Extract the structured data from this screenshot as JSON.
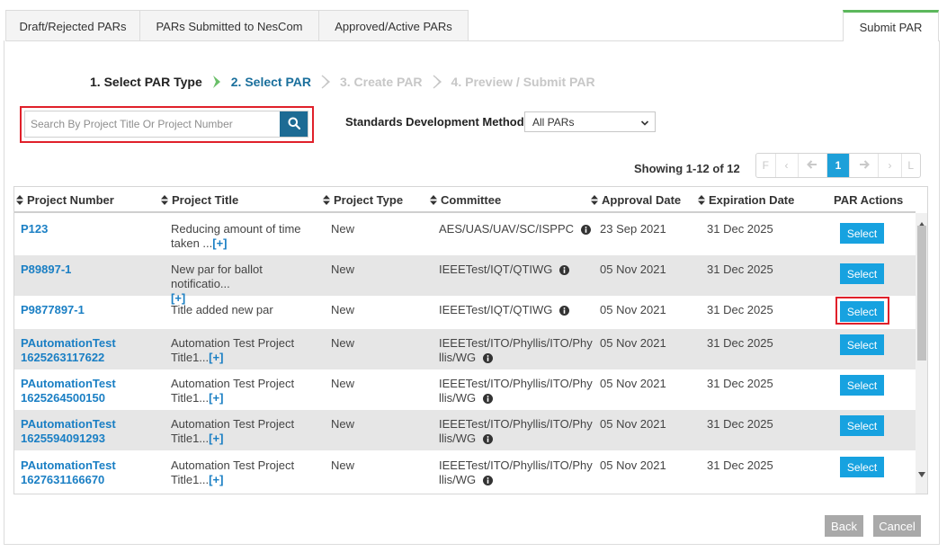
{
  "tabs": [
    {
      "label": "Draft/Rejected PARs"
    },
    {
      "label": "PARs Submitted to NesCom"
    },
    {
      "label": "Approved/Active PARs"
    },
    {
      "label": "Submit PAR"
    }
  ],
  "wizard": {
    "steps": [
      {
        "label": "1. Select PAR Type",
        "state": "done"
      },
      {
        "label": "2. Select PAR",
        "state": "current"
      },
      {
        "label": "3. Create PAR",
        "state": "future"
      },
      {
        "label": "4. Preview / Submit PAR",
        "state": "future"
      }
    ]
  },
  "search": {
    "placeholder": "Search By Project Title Or Project Number",
    "value": ""
  },
  "filter": {
    "label": "Standards Development Method:",
    "selected": "All PARs"
  },
  "pagination": {
    "showing": "Showing 1-12 of 12",
    "first": "F",
    "prev_small": "‹",
    "prev": "←",
    "current_page": "1",
    "next": "→",
    "next_small": "›",
    "last": "L"
  },
  "table": {
    "columns": [
      "Project Number",
      "Project Title",
      "Project Type",
      "Committee",
      "Approval Date",
      "Expiration Date",
      "PAR Actions"
    ],
    "rows": [
      {
        "number": "P123",
        "title": "Reducing amount of time taken ...",
        "more": "[+]",
        "type": "New",
        "committee": "AES/UAS/UAV/SC/ISPPC",
        "approval": "23 Sep 2021",
        "expiration": "31 Dec 2025",
        "action": "Select"
      },
      {
        "number": "P89897-1",
        "title": "New par for ballot notificatio...",
        "more": "[+]",
        "type": "New",
        "committee": "IEEETest/IQT/QTIWG",
        "approval": "05 Nov 2021",
        "expiration": "31 Dec 2025",
        "action": "Select"
      },
      {
        "number": "P9877897-1",
        "title": "Title added new par",
        "more": "",
        "type": "New",
        "committee": "IEEETest/IQT/QTIWG",
        "approval": "05 Nov 2021",
        "expiration": "31 Dec 2025",
        "action": "Select"
      },
      {
        "number": "PAutomationTest1625263117622",
        "title": "Automation Test Project Title1...",
        "more": "[+]",
        "type": "New",
        "committee": "IEEETest/ITO/Phyllis/ITO/Phyllis/WG",
        "approval": "05 Nov 2021",
        "expiration": "31 Dec 2025",
        "action": "Select"
      },
      {
        "number": "PAutomationTest1625264500150",
        "title": "Automation Test Project Title1...",
        "more": "[+]",
        "type": "New",
        "committee": "IEEETest/ITO/Phyllis/ITO/Phyllis/WG",
        "approval": "05 Nov 2021",
        "expiration": "31 Dec 2025",
        "action": "Select"
      },
      {
        "number": "PAutomationTest1625594091293",
        "title": "Automation Test Project Title1...",
        "more": "[+]",
        "type": "New",
        "committee": "IEEETest/ITO/Phyllis/ITO/Phyllis/WG",
        "approval": "05 Nov 2021",
        "expiration": "31 Dec 2025",
        "action": "Select"
      },
      {
        "number": "PAutomationTest1627631166670",
        "title": "Automation Test Project Title1...",
        "more": "[+]",
        "type": "New",
        "committee": "IEEETest/ITO/Phyllis/ITO/Phyllis/WG",
        "approval": "05 Nov 2021",
        "expiration": "31 Dec 2025",
        "action": "Select"
      }
    ]
  },
  "footer": {
    "back": "Back",
    "cancel": "Cancel"
  },
  "colors": {
    "accent_blue": "#1d6b94",
    "select_button": "#17a2e0",
    "link_blue": "#1a7fc4",
    "active_tab_border": "#5cb85c",
    "highlight_red": "#e0202a"
  }
}
